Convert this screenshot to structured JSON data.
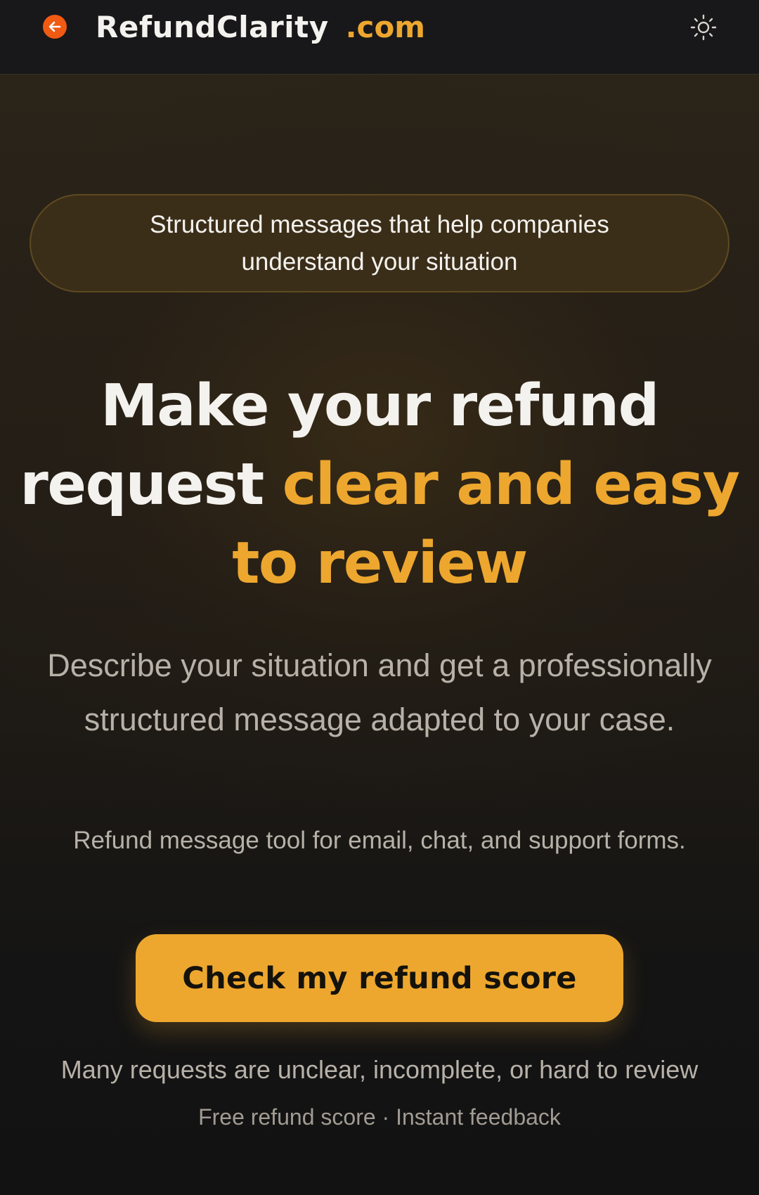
{
  "header": {
    "brand_name": "RefundClarity",
    "brand_tld": ".com",
    "back_icon": "arrow-left-icon",
    "theme_icon": "sun-icon"
  },
  "hero": {
    "badge": "Structured messages that help companies understand your situation",
    "headline_plain": "Make your refund request",
    "headline_accent": "clear and easy to review",
    "lead": "Describe your situation and get a professionally structured message adapted to your case.",
    "sub": "Refund message tool for email, chat, and support forms.",
    "cta_label": "Check my refund score",
    "note": "Many requests are unclear, incomplete, or hard to review",
    "meta": "Free refund score · Instant feedback"
  },
  "colors": {
    "accent": "#eda72e",
    "back_button": "#f05a12",
    "background": "#121213"
  }
}
